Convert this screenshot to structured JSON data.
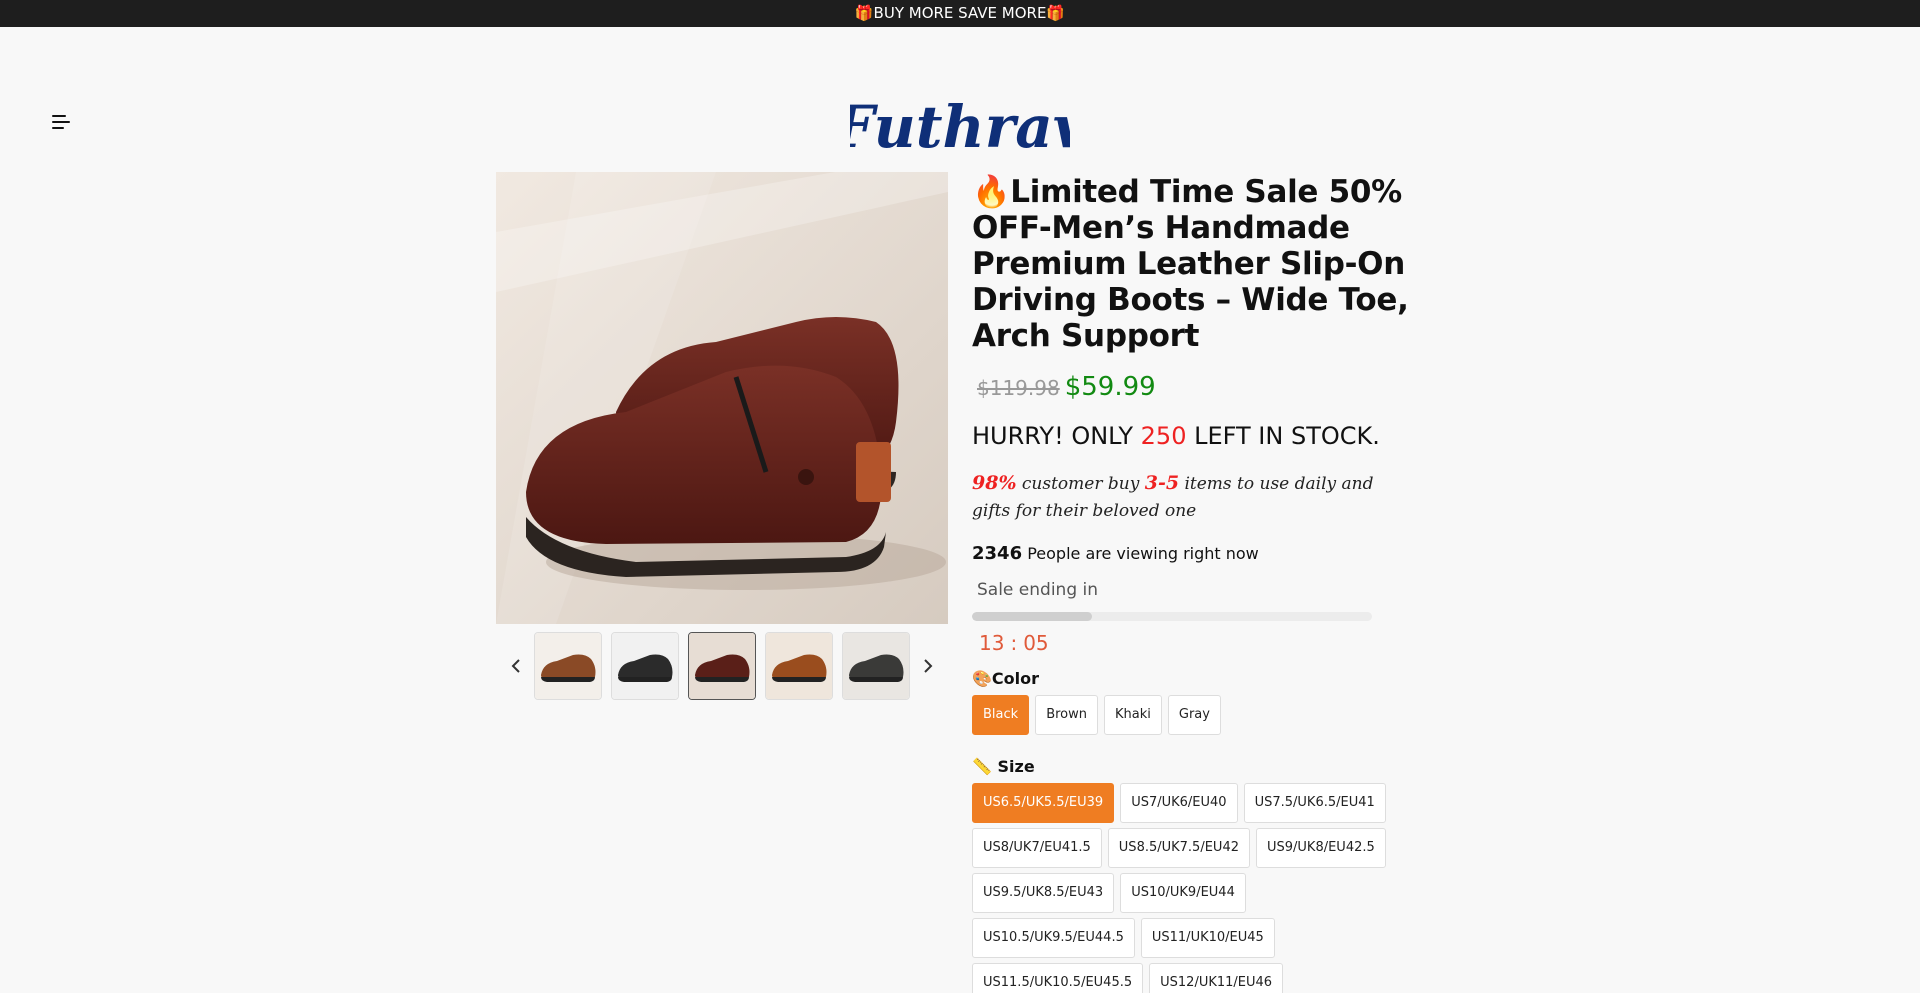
{
  "announcement": "🎁BUY MORE SAVE MORE🎁",
  "header": {
    "logo_text": "Futhrav"
  },
  "product": {
    "title": "🔥Limited Time Sale 50% OFF-Men’s Handmade Premium Leather Slip-On Driving Boots – Wide Toe, Arch Support",
    "old_price": "$119.98",
    "new_price": "$59.99",
    "stock_prefix": "HURRY! ONLY ",
    "stock_count": "250",
    "stock_suffix": " LEFT IN STOCK.",
    "promo_pct": "98%",
    "promo_mid": " customer buy ",
    "promo_range": "3-5",
    "promo_end": " items to use daily and gifts for their beloved one",
    "viewers_count": "2346",
    "viewers_text": " People are viewing right now",
    "sale_label": "Sale ending in",
    "sale_progress": 0.3,
    "timer_hours": "13",
    "timer_sep": ":",
    "timer_minutes": "05",
    "color_label": "🎨Color",
    "colors": [
      "Black",
      "Brown",
      "Khaki",
      "Gray"
    ],
    "selected_color": "Black",
    "size_label": "📏 Size",
    "sizes": [
      "US6.5/UK5.5/EU39",
      "US7/UK6/EU40",
      "US7.5/UK6.5/EU41",
      "US8/UK7/EU41.5",
      "US8.5/UK7.5/EU42",
      "US9/UK8/EU42.5",
      "US9.5/UK8.5/EU43",
      "US10/UK9/EU44",
      "US10.5/UK9.5/EU44.5",
      "US11/UK10/EU45",
      "US11.5/UK10.5/EU45.5",
      "US12/UK11/EU46"
    ],
    "selected_size": "US6.5/UK5.5/EU39"
  },
  "gallery": {
    "thumbs": [
      {
        "color": "#8a4a26",
        "bg": "#f3efea"
      },
      {
        "color": "#2b2b2b",
        "bg": "#f1f1f1"
      },
      {
        "color": "#5a1f18",
        "bg": "#e7ddd4"
      },
      {
        "color": "#9a4d1e",
        "bg": "#efe6dc"
      },
      {
        "color": "#3a3a38",
        "bg": "#e9e6e2"
      }
    ],
    "active_index": 2
  }
}
